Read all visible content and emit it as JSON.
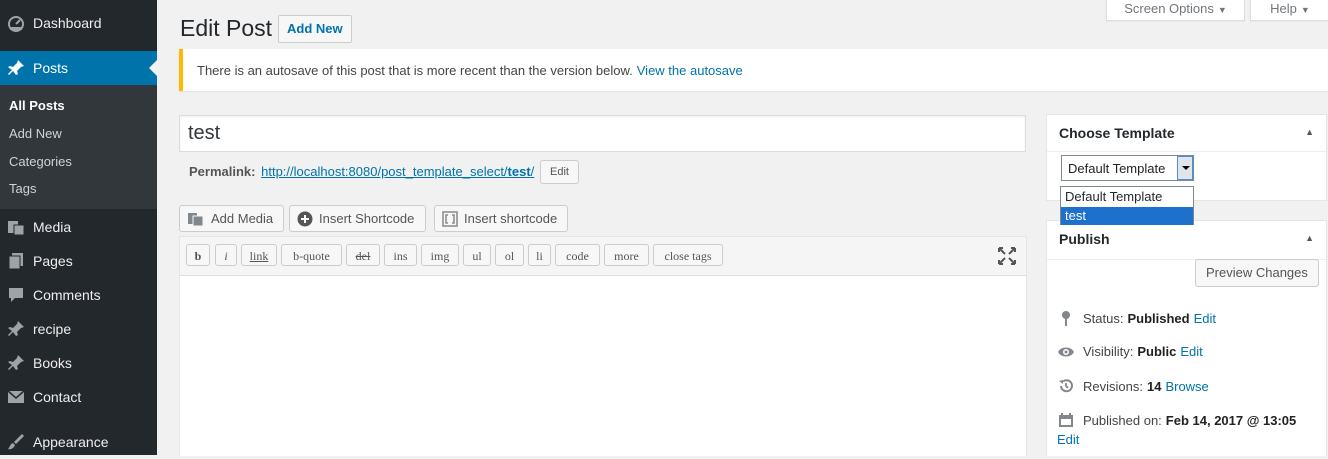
{
  "sidebar": {
    "items": [
      {
        "label": "Dashboard",
        "icon": "dashboard-icon"
      },
      {
        "label": "Posts",
        "icon": "pin-icon"
      },
      {
        "label": "Media",
        "icon": "media-icon"
      },
      {
        "label": "Pages",
        "icon": "pages-icon"
      },
      {
        "label": "Comments",
        "icon": "comments-icon"
      },
      {
        "label": "recipe",
        "icon": "pin-icon"
      },
      {
        "label": "Books",
        "icon": "pin-icon"
      },
      {
        "label": "Contact",
        "icon": "mail-icon"
      },
      {
        "label": "Appearance",
        "icon": "brush-icon"
      }
    ],
    "posts_submenu": [
      "All Posts",
      "Add New",
      "Categories",
      "Tags"
    ],
    "accent_color": "#0073aa",
    "background_color": "#23282d"
  },
  "header": {
    "title": "Edit Post",
    "add_new_label": "Add New",
    "screen_options_label": "Screen Options",
    "help_label": "Help"
  },
  "notice": {
    "text": "There is an autosave of this post that is more recent than the version below.",
    "link_label": "View the autosave",
    "border_color": "#ffb900"
  },
  "post": {
    "title": "test",
    "permalink_label": "Permalink:",
    "permalink_base": "http://localhost:8080/post_template_select/",
    "permalink_slug": "test",
    "permalink_suffix": "/",
    "permalink_edit_label": "Edit"
  },
  "media_buttons": {
    "add_media": "Add Media",
    "insert_shortcode": "Insert Shortcode",
    "insert_shortcode_2": "Insert shortcode"
  },
  "quicktags": [
    "b",
    "i",
    "link",
    "b-quote",
    "del",
    "ins",
    "img",
    "ul",
    "ol",
    "li",
    "code",
    "more",
    "close tags"
  ],
  "choose_template": {
    "title": "Choose Template",
    "selected": "Default Template",
    "options": [
      "Default Template",
      "test"
    ],
    "highlighted_option": "test"
  },
  "publish": {
    "title": "Publish",
    "preview_label": "Preview Changes",
    "status_label": "Status:",
    "status_value": "Published",
    "visibility_label": "Visibility:",
    "visibility_value": "Public",
    "revisions_label": "Revisions:",
    "revisions_value": "14",
    "browse_label": "Browse",
    "published_on_label": "Published on:",
    "published_on_value": "Feb 14, 2017 @ 13:05",
    "edit_label": "Edit"
  }
}
